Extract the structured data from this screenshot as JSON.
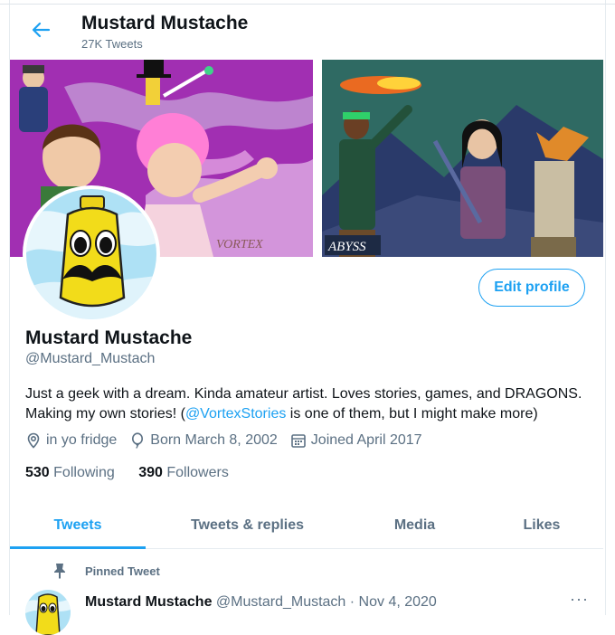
{
  "header": {
    "title": "Mustard Mustache",
    "tweet_count": "27K Tweets"
  },
  "profile": {
    "name": "Mustard Mustache",
    "handle": "@Mustard_Mustach",
    "edit_label": "Edit profile",
    "bio_line1": "Just a geek with a dream. Kinda amateur artist. Loves stories, games, and DRAGONS.",
    "bio_line2_pre": "Making my own stories! (",
    "bio_link": "@VortexStories",
    "bio_line2_post": " is one of them, but I might make more)",
    "location": "in yo fridge",
    "birthday": "Born March 8, 2002",
    "joined": "Joined April 2017",
    "following_count": "530",
    "following_label": "Following",
    "followers_count": "390",
    "followers_label": "Followers"
  },
  "banner": {
    "left_signature": "VORTEX",
    "right_signature": "ABYSS"
  },
  "tabs": [
    {
      "label": "Tweets"
    },
    {
      "label": "Tweets & replies"
    },
    {
      "label": "Media"
    },
    {
      "label": "Likes"
    }
  ],
  "pinned": {
    "label": "Pinned Tweet",
    "author": "Mustard Mustache",
    "handle_date": "@Mustard_Mustach · Nov 4, 2020",
    "more": "···"
  },
  "colors": {
    "accent": "#1da1f2",
    "secondary_text": "#5b7083",
    "mustard": "#f2dc1a"
  }
}
